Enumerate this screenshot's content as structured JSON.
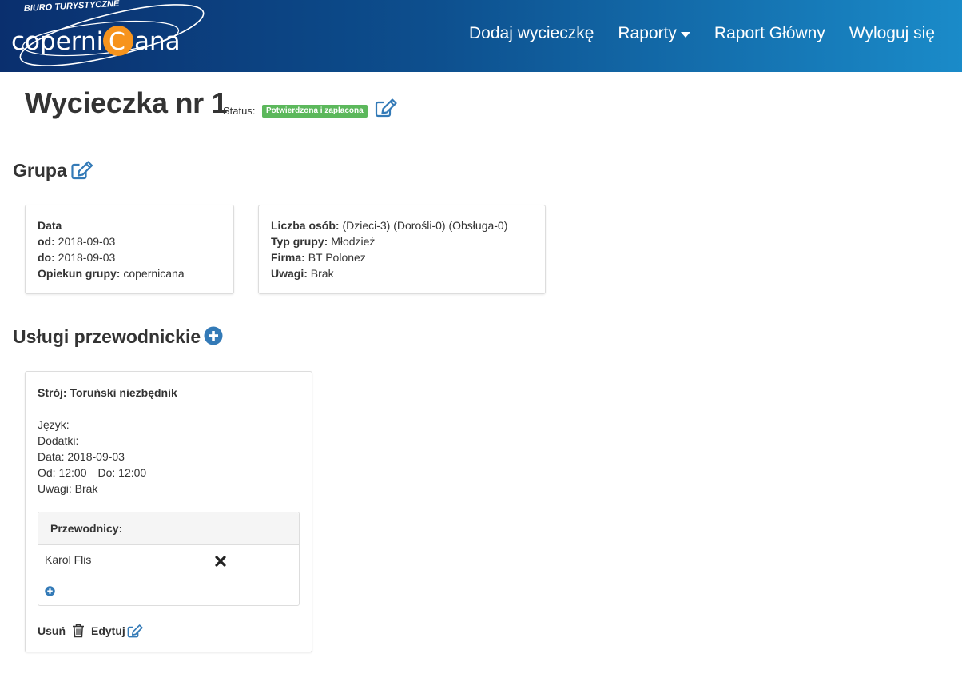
{
  "header": {
    "logo": {
      "top_text": "BIURO TURYSTYCZNE",
      "left_text": "coperni",
      "center_letter": "C",
      "right_text": "ana"
    },
    "nav": {
      "add_trip": "Dodaj wycieczkę",
      "reports": "Raporty",
      "main_report": "Raport Główny",
      "logout": "Wyloguj się"
    },
    "colors": {
      "gradient_start": "#0a2f6e",
      "gradient_end": "#1a8bc9",
      "logo_accent": "#f7941d"
    }
  },
  "trip": {
    "title": "Wycieczka nr 1",
    "status_label": "Status:",
    "status": "Potwierdzona i zapłacona",
    "status_color": "#5cb85c"
  },
  "group": {
    "heading": "Grupa",
    "left": {
      "date_label": "Data",
      "from_label": "od:",
      "from_value": "2018-09-03",
      "to_label": "do:",
      "to_value": "2018-09-03",
      "guardian_label": "Opiekun grupy:",
      "guardian_value": "copernicana"
    },
    "right": {
      "people_label": "Liczba osób:",
      "people_value": "(Dzieci-3) (Dorośli-0) (Obsługa-0)",
      "type_label": "Typ grupy:",
      "type_value": "Młodzież",
      "company_label": "Firma:",
      "company_value": "BT Polonez",
      "notes_label": "Uwagi:",
      "notes_value": "Brak"
    }
  },
  "services": {
    "heading": "Usługi przewodnickie",
    "items": [
      {
        "costume": "Strój: Toruński niezbędnik",
        "language": "Język:",
        "extras": "Dodatki:",
        "date": "Data: 2018-09-03",
        "from": "Od: 12:00",
        "to": "Do: 12:00",
        "notes": "Uwagi: Brak",
        "guides_heading": "Przewodnicy:",
        "guides": [
          "Karol Flis"
        ],
        "delete_label": "Usuń",
        "edit_label": "Edytuj"
      }
    ]
  },
  "icons": {
    "edit": "edit-icon",
    "add": "plus-circle-icon",
    "remove": "close-icon",
    "trash": "trash-icon",
    "caret": "caret-down-icon"
  },
  "accent_color": "#337ab7"
}
